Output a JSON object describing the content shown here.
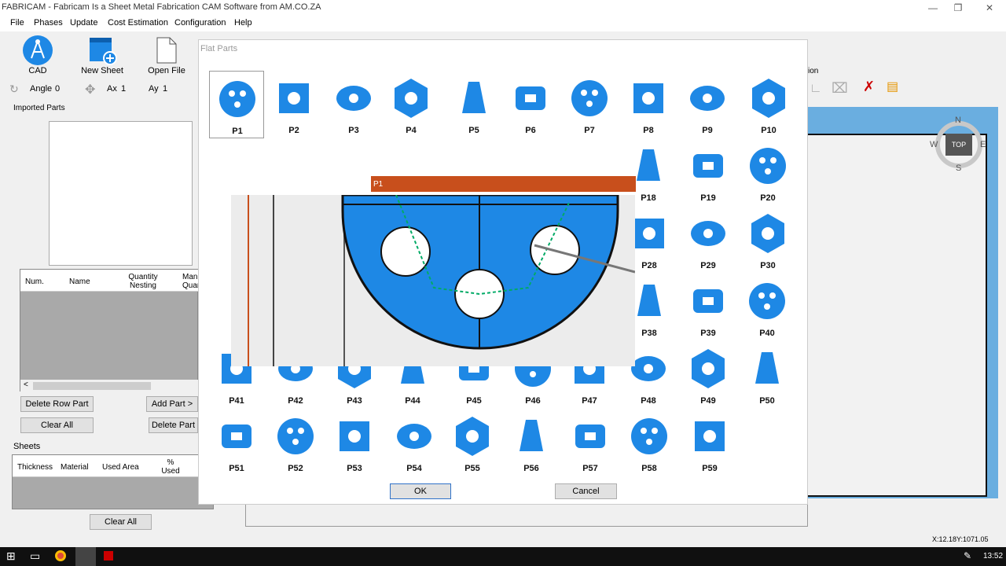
{
  "window": {
    "title": "FABRICAM - Fabricam Is a Sheet Metal Fabrication CAM Software from AM.CO.ZA"
  },
  "menu": [
    "File",
    "Phases",
    "Update",
    "Cost Estimation",
    "Configuration",
    "Help"
  ],
  "toolbar": {
    "cad": "CAD",
    "new_sheet": "New Sheet",
    "open_file": "Open File",
    "angle_label": "Angle",
    "angle_value": "0",
    "ax_label": "Ax",
    "ax_value": "1",
    "ay_label": "Ay",
    "ay_value": "1",
    "right_label": "ion"
  },
  "imported": {
    "title": "Imported Parts",
    "cols": [
      "Num.",
      "Name",
      "Quantity Nesting",
      "Man Quan"
    ]
  },
  "buttons": {
    "delete_row": "Delete Row Part",
    "add_part": "Add Part >",
    "clear_all": "Clear All",
    "delete_part": "Delete Part",
    "clear_all_2": "Clear All"
  },
  "sheets": {
    "title": "Sheets",
    "cols": [
      "Thickness",
      "Material",
      "Used Area",
      "% Used"
    ]
  },
  "dialog": {
    "title": "Flat Parts",
    "ok": "OK",
    "cancel": "Cancel",
    "parts": [
      "P1",
      "P2",
      "P3",
      "P4",
      "P5",
      "P6",
      "P7",
      "P8",
      "P9",
      "P10",
      "P18",
      "P19",
      "P20",
      "P28",
      "P29",
      "P30",
      "P38",
      "P39",
      "P40",
      "P41",
      "P42",
      "P43",
      "P44",
      "P45",
      "P46",
      "P47",
      "P48",
      "P49",
      "P50",
      "P51",
      "P52",
      "P53",
      "P54",
      "P55",
      "P56",
      "P57",
      "P58",
      "P59"
    ]
  },
  "preview": {
    "title": "P1"
  },
  "compass": {
    "n": "N",
    "s": "S",
    "w": "W",
    "e": "E",
    "top": "TOP"
  },
  "status": {
    "coords": "X:12.18Y:1071.05"
  },
  "taskbar": {
    "time": "13:52"
  },
  "colors": {
    "part_blue": "#1e88e5",
    "preview_title": "#c84f1c",
    "canvas_blue": "#6aaee0"
  }
}
